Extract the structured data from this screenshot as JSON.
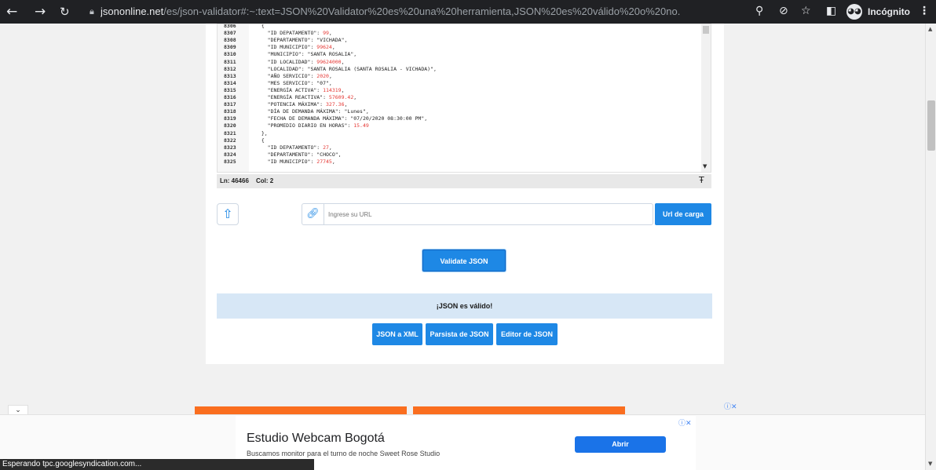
{
  "browser": {
    "url_host": "jsononline.net",
    "url_rest": "/es/json-validator#:~:text=JSON%20Validator%20es%20una%20herramienta,JSON%20es%20válido%20o%20no.",
    "incognito_label": "Incógnito",
    "icons": {
      "back": "arrow-left-icon",
      "forward": "arrow-right-icon",
      "reload": "reload-icon",
      "lock": "lock-icon",
      "zoom": "magnifier-icon",
      "tracking": "eye-slash-icon",
      "bookmark": "star-icon",
      "sidepanel": "panel-icon",
      "menu": "kebab-menu-icon"
    }
  },
  "editor": {
    "lines": [
      {
        "n": "8306",
        "code": "  {"
      },
      {
        "n": "8307",
        "key": "    \"ID DEPATAMENTO\": ",
        "num": "99",
        "tail": ","
      },
      {
        "n": "8308",
        "code": "    \"DEPARTAMENTO\": \"VICHADA\","
      },
      {
        "n": "8309",
        "key": "    \"ID MUNICIPIO\": ",
        "num": "99624",
        "tail": ","
      },
      {
        "n": "8310",
        "code": "    \"MUNICIPIO\": \"SANTA ROSALIA\","
      },
      {
        "n": "8311",
        "key": "    \"ID LOCALIDAD\": ",
        "num": "99624000",
        "tail": ","
      },
      {
        "n": "8312",
        "code": "    \"LOCALIDAD\": \"SANTA ROSALIA (SANTA ROSALIA - VICHADA)\","
      },
      {
        "n": "8313",
        "key": "    \"AÑO SERVICIO\": ",
        "num": "2020",
        "tail": ","
      },
      {
        "n": "8314",
        "code": "    \"MES SERVICIO\": \"07\","
      },
      {
        "n": "8315",
        "key": "    \"ENERGÍA ACTIVA\": ",
        "num": "114319",
        "tail": ","
      },
      {
        "n": "8316",
        "key": "    \"ENERGÍA REACTIVA\": ",
        "num": "57609.42",
        "tail": ","
      },
      {
        "n": "8317",
        "key": "    \"POTENCIA MÁXIMA\": ",
        "num": "327.36",
        "tail": ","
      },
      {
        "n": "8318",
        "code": "    \"DÍA DE DEMANDA MÁXIMA\": \"Lunes\","
      },
      {
        "n": "8319",
        "code": "    \"FECHA DE DEMANDA MÁXIMA\": \"07/20/2020 08:30:00 PM\","
      },
      {
        "n": "8320",
        "key": "    \"PROMEDIO DIARIO EN HORAS\": ",
        "num": "15.49",
        "tail": ""
      },
      {
        "n": "8321",
        "code": "  },"
      },
      {
        "n": "8322",
        "code": "  {"
      },
      {
        "n": "8323",
        "key": "    \"ID DEPATAMENTO\": ",
        "num": "27",
        "tail": ","
      },
      {
        "n": "8324",
        "code": "    \"DEPARTAMENTO\": \"CHOCO\","
      },
      {
        "n": "8325",
        "key": "    \"ID MUNICIPIO\": ",
        "num": "27745",
        "tail": ","
      }
    ],
    "status_ln": "Ln: 46466",
    "status_col": "Col: 2"
  },
  "url_loader": {
    "placeholder": "Ingrese su URL",
    "load_button": "Url de carga",
    "icons": {
      "upload": "upload-icon",
      "link": "link-icon"
    }
  },
  "validate_button": "Validate JSON",
  "result_text": "¡JSON es válido!",
  "tools": {
    "to_xml": "JSON a XML",
    "parser": "Parsista de JSON",
    "editor": "Editor de JSON"
  },
  "ad": {
    "title": "Estudio Webcam Bogotá",
    "description": "Buscamos monitor para el turno de noche Sweet Rose Studio",
    "button": "Abrir"
  },
  "status_message": "Esperando tpc.googlesyndication.com...",
  "colors": {
    "accent": "#1e88e5",
    "valid_bg": "#d7e7f6",
    "ad_orange": "#fa6e1f",
    "json_number": "#e53935"
  }
}
